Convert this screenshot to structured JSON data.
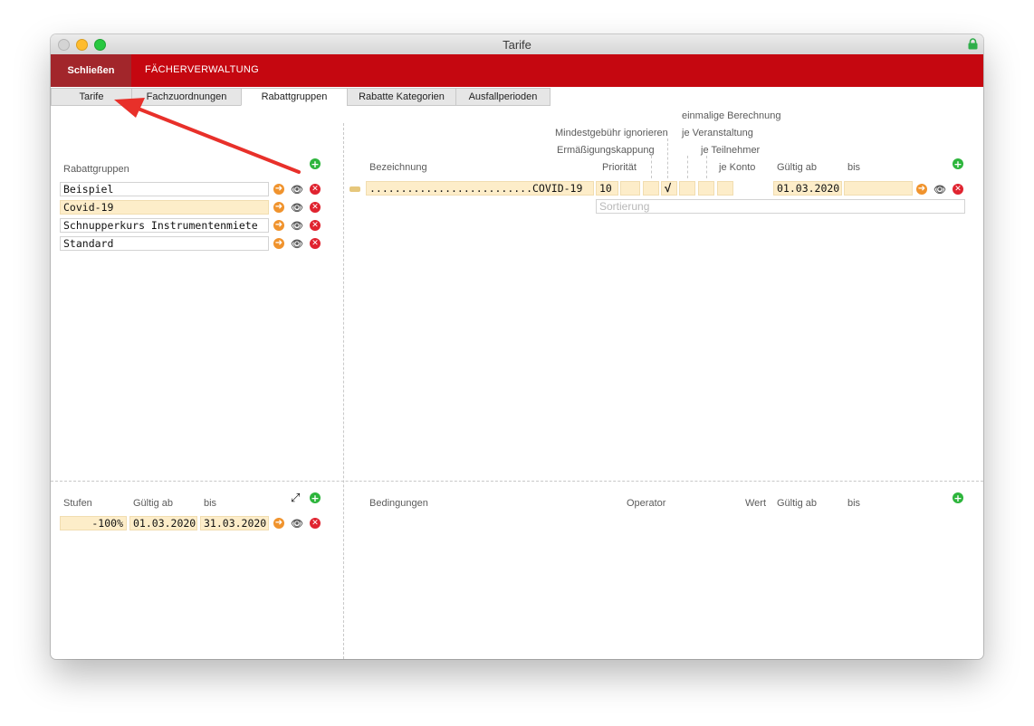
{
  "window": {
    "title": "Tarife"
  },
  "toolbar": {
    "close_label": "Schließen",
    "section_label": "FÄCHERVERWALTUNG"
  },
  "tabs": [
    {
      "label": "Tarife"
    },
    {
      "label": "Fachzuordnungen"
    },
    {
      "label": "Rabattgruppen"
    },
    {
      "label": "Rabatte Kategorien"
    },
    {
      "label": "Ausfallperioden"
    }
  ],
  "rabattgruppen": {
    "header": "Rabattgruppen",
    "items": [
      {
        "name": "Beispiel"
      },
      {
        "name": "Covid-19"
      },
      {
        "name": "Schnupperkurs Instrumentenmiete"
      },
      {
        "name": "Standard"
      }
    ]
  },
  "rabatte": {
    "headers": {
      "bezeichnung": "Bezeichnung",
      "prioritaet": "Priorität",
      "ermaessigungskappung": "Ermäßigungskappung",
      "mindestgebuehr": "Mindestgebühr ignorieren",
      "einmalige": "einmalige Berechnung",
      "je_veranstaltung": "je Veranstaltung",
      "je_teilnehmer": "je Teilnehmer",
      "je_konto": "je Konto",
      "gueltig_ab": "Gültig ab",
      "bis": "bis"
    },
    "row": {
      "bezeichnung": "..........................COVID-19",
      "prioritaet": "10",
      "check": "√",
      "gueltig_ab": "01.03.2020",
      "bis": ""
    },
    "sortierung_placeholder": "Sortierung"
  },
  "stufen": {
    "headers": {
      "stufen": "Stufen",
      "gueltig_ab": "Gültig ab",
      "bis": "bis"
    },
    "row": {
      "value": "-100%",
      "gueltig_ab": "01.03.2020",
      "bis": "31.03.2020"
    }
  },
  "bedingungen": {
    "headers": {
      "bedingungen": "Bedingungen",
      "operator": "Operator",
      "wert": "Wert",
      "gueltig_ab": "Gültig ab",
      "bis": "bis"
    }
  },
  "colors": {
    "brand_red": "#c50710",
    "close_button": "#a2262b",
    "highlight": "#fdedc9",
    "annotation_arrow": "#e8302a"
  },
  "icons": {
    "add": "plus-circle-icon",
    "go": "arrow-right-circle-icon",
    "view": "eye-icon",
    "delete": "x-circle-icon",
    "expand": "expand-icon",
    "lock": "lock-icon"
  }
}
